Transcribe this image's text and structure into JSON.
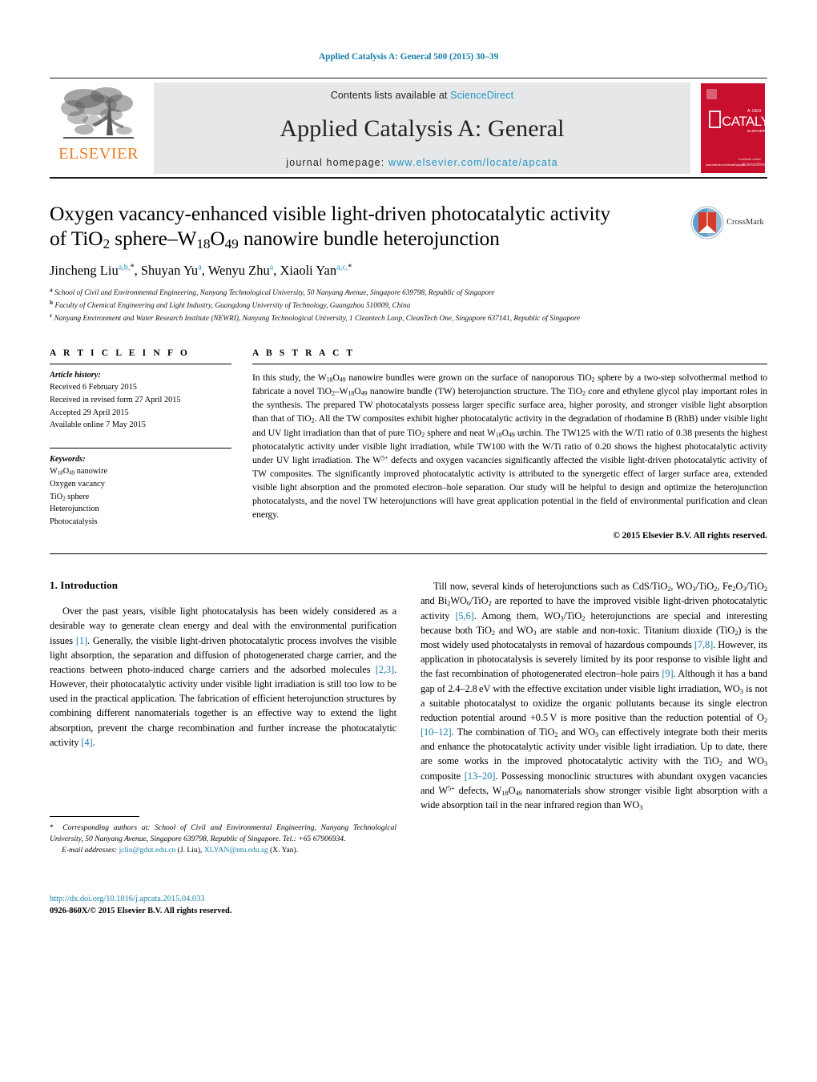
{
  "running_head": "Applied Catalysis A: General 500 (2015) 30–39",
  "masthead": {
    "contents_prefix": "Contents lists available at ",
    "sciencedirect": "ScienceDirect",
    "journal_title": "Applied Catalysis A: General",
    "homepage_prefix": "journal homepage: ",
    "homepage_url": "www.elsevier.com/locate/apcata",
    "publisher_wordmark": "ELSEVIER",
    "publisher_color": "#ef7d22",
    "cover_text": "CATALYSIS",
    "cover_color": "#c8102e",
    "link_color": "#2196c4"
  },
  "article": {
    "title_line1": "Oxygen vacancy-enhanced visible light-driven photocatalytic activity",
    "title_line2_pre": "of TiO",
    "title_line2_sub1": "2",
    "title_line2_mid": " sphere–W",
    "title_line2_sub2": "18",
    "title_line2_o": "O",
    "title_line2_sub3": "49",
    "title_line2_post": " nanowire bundle heterojunction",
    "crossmark_label": "CrossMark"
  },
  "authors": [
    {
      "name": "Jincheng Liu",
      "marks": "a,b,",
      "star": "*",
      "sep": ", "
    },
    {
      "name": "Shuyan Yu",
      "marks": "a",
      "star": "",
      "sep": ", "
    },
    {
      "name": "Wenyu Zhu",
      "marks": "a",
      "star": "",
      "sep": ", "
    },
    {
      "name": "Xiaoli Yan",
      "marks": "a,c,",
      "star": "*",
      "sep": ""
    }
  ],
  "affiliations": [
    {
      "mark": "a",
      "text": "School of Civil and Environmental Engineering, Nanyang Technological University, 50 Nanyang Avenue, Singapore 639798, Republic of Singapore"
    },
    {
      "mark": "b",
      "text": "Faculty of Chemical Engineering and Light Industry, Guangdong University of Technology, Guangzhou 510009, China"
    },
    {
      "mark": "c",
      "text": "Nanyang Environment and Water Research Institute (NEWRI), Nanyang Technological University, 1 Cleantech Loop, CleanTech One, Singapore 637141, Republic of Singapore"
    }
  ],
  "article_info": {
    "heading": "A R T I C L E   I N F O",
    "history_label": "Article history:",
    "history": [
      "Received 6 February 2015",
      "Received in revised form 27 April 2015",
      "Accepted 29 April 2015",
      "Available online 7 May 2015"
    ],
    "keywords_label": "Keywords:",
    "keywords": [
      "W18O49 nanowire",
      "Oxygen vacancy",
      "TiO2 sphere",
      "Heterojunction",
      "Photocatalysis"
    ]
  },
  "abstract": {
    "heading": "A B S T R A C T",
    "text": "In this study, the W18O49 nanowire bundles were grown on the surface of nanoporous TiO2 sphere by a two-step solvothermal method to fabricate a novel TiO2–W18O49 nanowire bundle (TW) heterojunction structure. The TiO2 core and ethylene glycol play important roles in the synthesis. The prepared TW photocatalysts possess larger specific surface area, higher porosity, and stronger visible light absorption than that of TiO2. All the TW composites exhibit higher photocatalytic activity in the degradation of rhodamine B (RhB) under visible light and UV light irradiation than that of pure TiO2 sphere and neat W18O49 urchin. The TW125 with the W/Ti ratio of 0.38 presents the highest photocatalytic activity under visible light irradiation, while TW100 with the W/Ti ratio of 0.20 shows the highest photocatalytic activity under UV light irradiation. The W5+ defects and oxygen vacancies significantly affected the visible light-driven photocatalytic activity of TW composites. The significantly improved photocatalytic activity is attributed to the synergetic effect of larger surface area, extended visible light absorption and the promoted electron–hole separation. Our study will be helpful to design and optimize the heterojunction photocatalysts, and the novel TW heterojunctions will have great application potential in the field of environmental purification and clean energy.",
    "copyright": "© 2015 Elsevier B.V. All rights reserved."
  },
  "introduction": {
    "heading": "1.  Introduction",
    "paragraph": "Over the past years, visible light photocatalysis has been widely considered as a desirable way to generate clean energy and deal with the environmental purification issues [1]. Generally, the visible light-driven photocatalytic process involves the visible light absorption, the separation and diffusion of photogenerated charge carrier, and the reactions between photo-induced charge carriers and the adsorbed molecules [2,3]. However, their photocatalytic activity under visible light irradiation is still too low to be used in the practical application. The fabrication of efficient heterojunction structures by combining different nanomaterials together is an effective way to extend the light absorption, prevent the charge recombination and further increase the photocatalytic activity [4].",
    "paragraph_right": "Till now, several kinds of heterojunctions such as CdS/TiO2, WO3/TiO2, Fe2O3/TiO2 and Bi2WO6/TiO2 are reported to have the improved visible light-driven photocatalytic activity [5,6]. Among them, WO3/TiO2 heterojunctions are special and interesting because both TiO2 and WO3 are stable and non-toxic. Titanium dioxide (TiO2) is the most widely used photocatalysts in removal of hazardous compounds [7,8]. However, its application in photocatalysis is severely limited by its poor response to visible light and the fast recombination of photogenerated electron–hole pairs [9]. Although it has a band gap of 2.4–2.8 eV with the effective excitation under visible light irradiation, WO3 is not a suitable photocatalyst to oxidize the organic pollutants because its single electron reduction potential around +0.5 V is more positive than the reduction potential of O2 [10–12]. The combination of TiO2 and WO3 can effectively integrate both their merits and enhance the photocatalytic activity under visible light irradiation. Up to date, there are some works in the improved photocatalytic activity with the TiO2 and WO3 composite [13–20]. Possessing monoclinic structures with abundant oxygen vacancies and W5+ defects, W18O49 nanomaterials show stronger visible light absorption with a wide absorption tail in the near infrared region than WO3"
  },
  "footnote": {
    "star": "*",
    "corresponding": "Corresponding authors at: School of Civil and Environmental Engineering, Nanyang Technological University, 50 Nanyang Avenue, Singapore 639798, Republic of Singapore. Tel.: +65 67906934.",
    "email_label": "E-mail addresses:",
    "email1": "jcliu@gdut.edu.cn",
    "email1_who": "(J. Liu),",
    "email2": "XLYAN@ntu.edu.sg",
    "email2_who": "(X. Yan)."
  },
  "doi_block": {
    "doi": "http://dx.doi.org/10.1016/j.apcata.2015.04.033",
    "issn": "0926-860X/© 2015 Elsevier B.V. All rights reserved."
  }
}
